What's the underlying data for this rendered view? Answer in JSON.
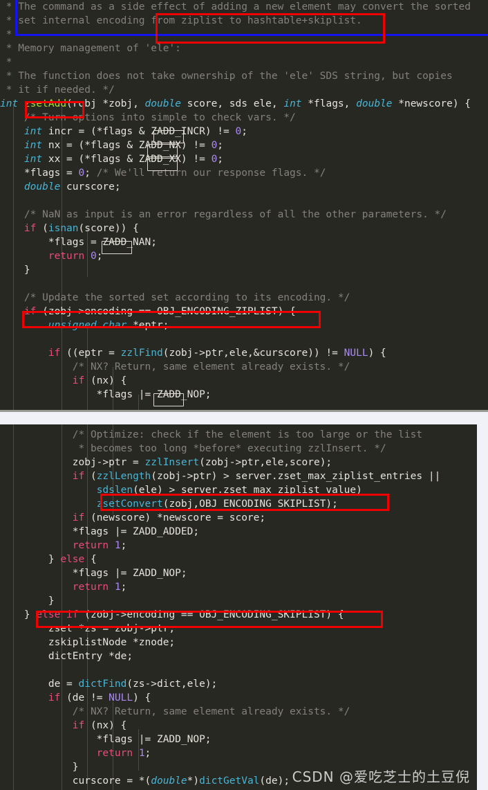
{
  "editor": {
    "theme_background": "#272822",
    "page_background": "#f0f2f7",
    "language": "C",
    "source": "redis t_zset.c zsetAdd"
  },
  "colors": {
    "comment": "#85817a",
    "keyword": "#ec4b7d",
    "type": "#49b5d6",
    "function": "#49b5d6",
    "function_def": "#a6e22e",
    "number": "#ab8af5",
    "plain": "#e6e3da",
    "annotation_red": "#f00000",
    "annotation_blue": "#1414f0",
    "annotation_white": "#dedad2"
  },
  "panel_top": {
    "lines": [
      " * The command as a side effect of adding a new element may convert the sorted",
      " * set internal encoding from ziplist to hashtable+skiplist.",
      " *",
      " * Memory management of 'ele':",
      " *",
      " * The function does not take ownership of the 'ele' SDS string, but copies",
      " * it if needed. */",
      "int zsetAdd(robj *zobj, double score, sds ele, int *flags, double *newscore) {",
      "    /* Turn options into simple to check vars. */",
      "    int incr = (*flags & ZADD_INCR) != 0;",
      "    int nx = (*flags & ZADD_NX) != 0;",
      "    int xx = (*flags & ZADD_XX) != 0;",
      "    *flags = 0; /* We'll return our response flags. */",
      "    double curscore;",
      "",
      "    /* NaN as input is an error regardless of all the other parameters. */",
      "    if (isnan(score)) {",
      "        *flags = ZADD_NAN;",
      "        return 0;",
      "    }",
      "",
      "    /* Update the sorted set according to its encoding. */",
      "    if (zobj->encoding == OBJ_ENCODING_ZIPLIST) {",
      "        unsigned char *eptr;",
      "",
      "        if ((eptr = zzlFind(zobj->ptr,ele,&curscore)) != NULL) {",
      "            /* NX? Return, same element already exists. */",
      "            if (nx) {",
      "                *flags |= ZADD_NOP;"
    ]
  },
  "panel_bottom": {
    "lines": [
      "            /* Optimize: check if the element is too large or the list",
      "             * becomes too long *before* executing zzlInsert. */",
      "            zobj->ptr = zzlInsert(zobj->ptr,ele,score);",
      "            if (zzlLength(zobj->ptr) > server.zset_max_ziplist_entries ||",
      "                sdslen(ele) > server.zset_max_ziplist_value)",
      "                zsetConvert(zobj,OBJ_ENCODING_SKIPLIST);",
      "            if (newscore) *newscore = score;",
      "            *flags |= ZADD_ADDED;",
      "            return 1;",
      "        } else {",
      "            *flags |= ZADD_NOP;",
      "            return 1;",
      "        }",
      "    } else if (zobj->encoding == OBJ_ENCODING_SKIPLIST) {",
      "        zset *zs = zobj->ptr;",
      "        zskiplistNode *znode;",
      "        dictEntry *de;",
      "",
      "        de = dictFind(zs->dict,ele);",
      "        if (de != NULL) {",
      "            /* NX? Return, same element already exists. */",
      "            if (nx) {",
      "                *flags |= ZADD_NOP;",
      "                return 1;",
      "            }",
      "            curscore = *(double*)dictGetVal(de);"
    ]
  },
  "annotations": {
    "blue_boxes": [
      {
        "name": "side-effect-comment-highlight",
        "text": "The command as a side effect of adding a new element may convert the sorted set internal encoding"
      }
    ],
    "red_boxes": [
      {
        "name": "ziplist-to-skiplist-highlight",
        "text": "from ziplist to hashtable+skiplist."
      },
      {
        "name": "zsetadd-function-name-highlight",
        "text": "zsetAdd("
      },
      {
        "name": "ziplist-branch-highlight",
        "text": "if (zobj->encoding == OBJ_ENCODING_ZIPLIST) {"
      },
      {
        "name": "zsetconvert-call-highlight",
        "text": "zsetConvert(zobj,OBJ_ENCODING_SKIPLIST);"
      },
      {
        "name": "skiplist-branch-highlight",
        "text": "else if (zobj->encoding == OBJ_ENCODING_SKIPLIST) {"
      }
    ],
    "white_boxes": [
      {
        "name": "zadd-incr-token-box",
        "text": "ZADD"
      },
      {
        "name": "zadd-nx-token-box",
        "text": "ZADD"
      },
      {
        "name": "zadd-xx-token-box",
        "text": "ZADD"
      },
      {
        "name": "zadd-nan-token-box",
        "text": "ZADD"
      },
      {
        "name": "zadd-nop-token-box",
        "text": "ZADD"
      }
    ]
  },
  "watermark": {
    "text": "CSDN @爱吃芝士的土豆倪"
  }
}
